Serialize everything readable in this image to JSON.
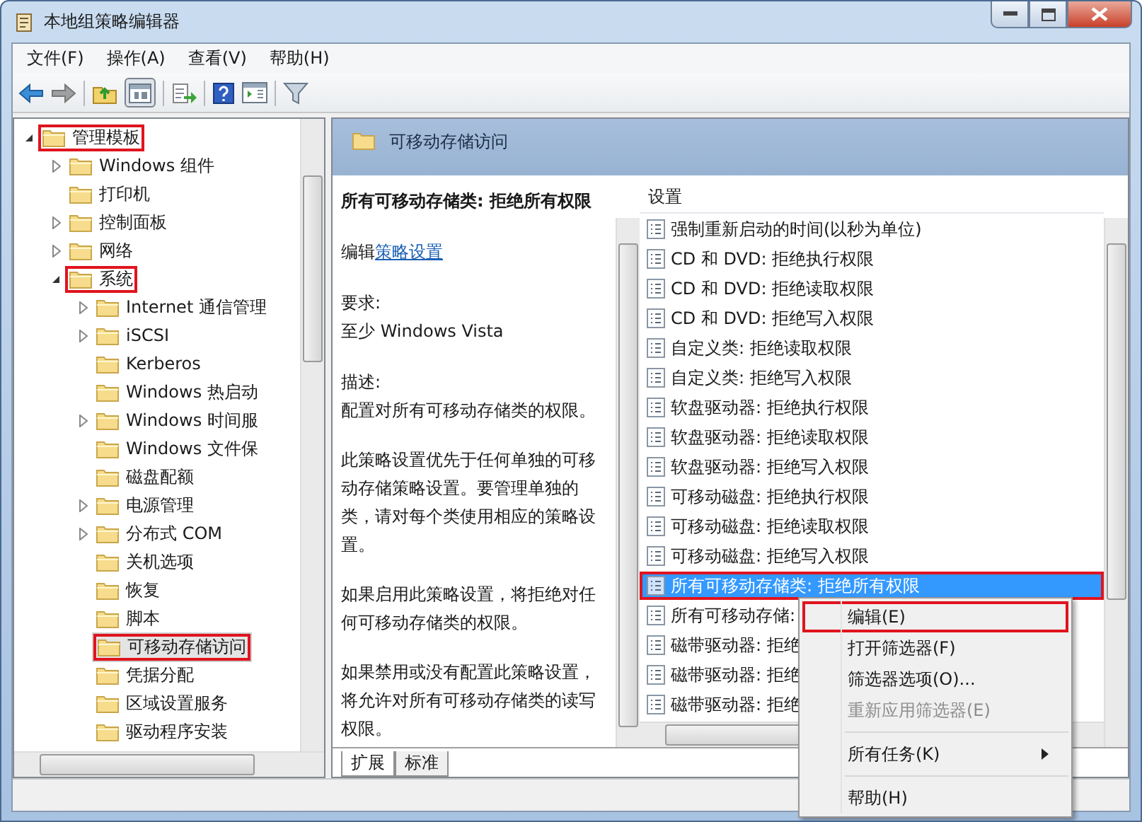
{
  "window": {
    "title": "本地组策略编辑器"
  },
  "menu": [
    "文件(F)",
    "操作(A)",
    "查看(V)",
    "帮助(H)"
  ],
  "tree": {
    "items": [
      {
        "label": "管理模板",
        "expandable": true,
        "expanded": true,
        "selected": false,
        "annotated": true,
        "children": [
          {
            "label": "Windows 组件",
            "expandable": true,
            "expanded": false,
            "selected": false,
            "annotated": false
          },
          {
            "label": "打印机",
            "expandable": false,
            "selected": false,
            "annotated": false
          },
          {
            "label": "控制面板",
            "expandable": true,
            "expanded": false,
            "selected": false,
            "annotated": false
          },
          {
            "label": "网络",
            "expandable": true,
            "expanded": false,
            "selected": false,
            "annotated": false
          },
          {
            "label": "系统",
            "expandable": true,
            "expanded": true,
            "selected": false,
            "annotated": true,
            "children": [
              {
                "label": "Internet 通信管理",
                "expandable": true,
                "expanded": false,
                "selected": false,
                "annotated": false
              },
              {
                "label": "iSCSI",
                "expandable": true,
                "expanded": false,
                "selected": false,
                "annotated": false
              },
              {
                "label": "Kerberos",
                "expandable": false,
                "selected": false,
                "annotated": false
              },
              {
                "label": "Windows 热启动",
                "expandable": false,
                "selected": false,
                "annotated": false
              },
              {
                "label": "Windows 时间服",
                "expandable": true,
                "expanded": false,
                "selected": false,
                "annotated": false
              },
              {
                "label": "Windows 文件保",
                "expandable": false,
                "selected": false,
                "annotated": false
              },
              {
                "label": "磁盘配额",
                "expandable": false,
                "selected": false,
                "annotated": false
              },
              {
                "label": "电源管理",
                "expandable": true,
                "expanded": false,
                "selected": false,
                "annotated": false
              },
              {
                "label": "分布式 COM",
                "expandable": true,
                "expanded": false,
                "selected": false,
                "annotated": false
              },
              {
                "label": "关机选项",
                "expandable": false,
                "selected": false,
                "annotated": false
              },
              {
                "label": "恢复",
                "expandable": false,
                "selected": false,
                "annotated": false
              },
              {
                "label": "脚本",
                "expandable": false,
                "selected": false,
                "annotated": false
              },
              {
                "label": "可移动存储访问",
                "expandable": false,
                "selected": true,
                "annotated": true
              },
              {
                "label": "凭据分配",
                "expandable": false,
                "selected": false,
                "annotated": false
              },
              {
                "label": "区域设置服务",
                "expandable": false,
                "selected": false,
                "annotated": false
              },
              {
                "label": "驱动程序安装",
                "expandable": false,
                "selected": false,
                "annotated": false
              }
            ]
          }
        ]
      }
    ]
  },
  "details": {
    "header": "可移动存储访问",
    "title": "所有可移动存储类: 拒绝所有权限",
    "edit_prefix": "编辑",
    "edit_link": "策略设置",
    "requirement_label": "要求:",
    "requirement": "至少 Windows Vista",
    "description_label": "描述:",
    "paragraphs": [
      "配置对所有可移动存储类的权限。",
      "此策略设置优先于任何单独的可移动存储策略设置。要管理单独的类，请对每个类使用相应的策略设置。",
      "如果启用此策略设置，将拒绝对任何可移动存储类的权限。",
      "如果禁用或没有配置此策略设置，将允许对所有可移动存储类的读写权限。"
    ]
  },
  "settings": {
    "column": "设置",
    "rows": [
      {
        "label": "强制重新启动的时间(以秒为单位)",
        "selected": false,
        "annotated": false
      },
      {
        "label": "CD 和 DVD: 拒绝执行权限",
        "selected": false,
        "annotated": false
      },
      {
        "label": "CD 和 DVD: 拒绝读取权限",
        "selected": false,
        "annotated": false
      },
      {
        "label": "CD 和 DVD: 拒绝写入权限",
        "selected": false,
        "annotated": false
      },
      {
        "label": "自定义类: 拒绝读取权限",
        "selected": false,
        "annotated": false
      },
      {
        "label": "自定义类: 拒绝写入权限",
        "selected": false,
        "annotated": false
      },
      {
        "label": "软盘驱动器: 拒绝执行权限",
        "selected": false,
        "annotated": false
      },
      {
        "label": "软盘驱动器: 拒绝读取权限",
        "selected": false,
        "annotated": false
      },
      {
        "label": "软盘驱动器: 拒绝写入权限",
        "selected": false,
        "annotated": false
      },
      {
        "label": "可移动磁盘: 拒绝执行权限",
        "selected": false,
        "annotated": false
      },
      {
        "label": "可移动磁盘: 拒绝读取权限",
        "selected": false,
        "annotated": false
      },
      {
        "label": "可移动磁盘: 拒绝写入权限",
        "selected": false,
        "annotated": false
      },
      {
        "label": "所有可移动存储类: 拒绝所有权限",
        "selected": true,
        "annotated": true
      },
      {
        "label": "所有可移动存储:",
        "selected": false,
        "annotated": false
      },
      {
        "label": "磁带驱动器: 拒绝",
        "selected": false,
        "annotated": false
      },
      {
        "label": "磁带驱动器: 拒绝",
        "selected": false,
        "annotated": false
      },
      {
        "label": "磁带驱动器: 拒绝",
        "selected": false,
        "annotated": false
      }
    ]
  },
  "tabs": [
    {
      "label": "扩展",
      "selected": true
    },
    {
      "label": "标准",
      "selected": false
    }
  ],
  "context_menu": {
    "items": [
      {
        "label": "编辑(E)",
        "disabled": false,
        "submenu": false,
        "separator_before": false,
        "annotated": true
      },
      {
        "label": "打开筛选器(F)",
        "disabled": false,
        "submenu": false,
        "separator_before": false,
        "annotated": false
      },
      {
        "label": "筛选器选项(O)...",
        "disabled": false,
        "submenu": false,
        "separator_before": false,
        "annotated": false
      },
      {
        "label": "重新应用筛选器(E)",
        "disabled": true,
        "submenu": false,
        "separator_before": false,
        "annotated": false
      },
      {
        "label": "所有任务(K)",
        "disabled": false,
        "submenu": true,
        "separator_before": true,
        "annotated": false
      },
      {
        "label": "帮助(H)",
        "disabled": false,
        "submenu": false,
        "separator_before": true,
        "annotated": false
      }
    ]
  }
}
